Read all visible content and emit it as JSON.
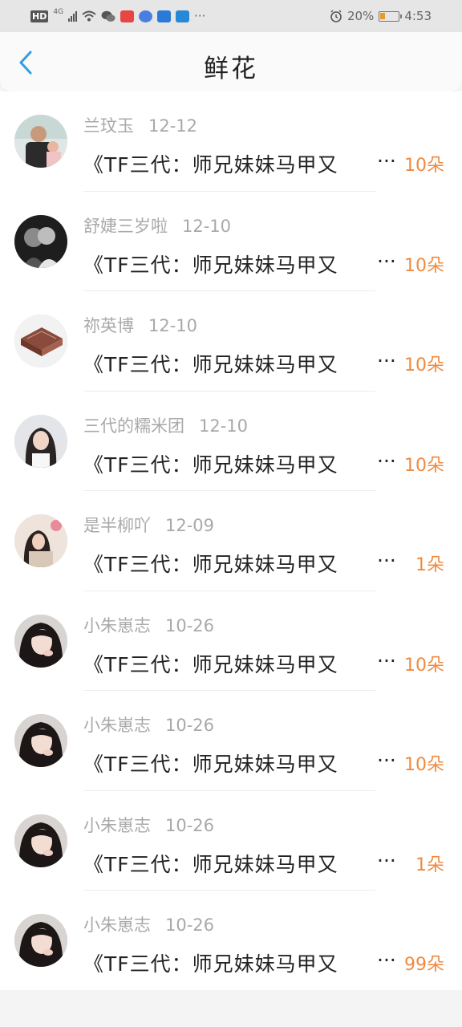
{
  "status_bar": {
    "hd": "HD",
    "network": "4G",
    "battery_percent": "20%",
    "time": "4:53",
    "more": "···"
  },
  "header": {
    "title": "鲜花",
    "back_icon": "chevron-left-icon"
  },
  "colors": {
    "accent": "#2e9fe6",
    "count": "#f08a40",
    "meta": "#a9a9a9"
  },
  "records": [
    {
      "name": "兰玟玉",
      "date": "12-12",
      "title": "《TF三代：师兄妹妹马甲又",
      "count": "10朵",
      "avatar": "man-with-child"
    },
    {
      "name": "舒婕三岁啦",
      "date": "12-10",
      "title": "《TF三代：师兄妹妹马甲又",
      "count": "10朵",
      "avatar": "couple-bw"
    },
    {
      "name": "祢英博",
      "date": "12-10",
      "title": "《TF三代：师兄妹妹马甲又",
      "count": "10朵",
      "avatar": "brown-cube"
    },
    {
      "name": "三代的糯米团",
      "date": "12-10",
      "title": "《TF三代：师兄妹妹马甲又",
      "count": "10朵",
      "avatar": "girl-long-hair"
    },
    {
      "name": "是半柳吖",
      "date": "12-09",
      "title": "《TF三代：师兄妹妹马甲又",
      "count": "1朵",
      "avatar": "girl-sitting"
    },
    {
      "name": "小朱崽志",
      "date": "10-26",
      "title": "《TF三代：师兄妹妹马甲又",
      "count": "10朵",
      "avatar": "girl-selfie"
    },
    {
      "name": "小朱崽志",
      "date": "10-26",
      "title": "《TF三代：师兄妹妹马甲又",
      "count": "10朵",
      "avatar": "girl-selfie"
    },
    {
      "name": "小朱崽志",
      "date": "10-26",
      "title": "《TF三代：师兄妹妹马甲又",
      "count": "1朵",
      "avatar": "girl-selfie"
    },
    {
      "name": "小朱崽志",
      "date": "10-26",
      "title": "《TF三代：师兄妹妹马甲又",
      "count": "99朵",
      "avatar": "girl-selfie"
    }
  ],
  "ellipsis": "···"
}
